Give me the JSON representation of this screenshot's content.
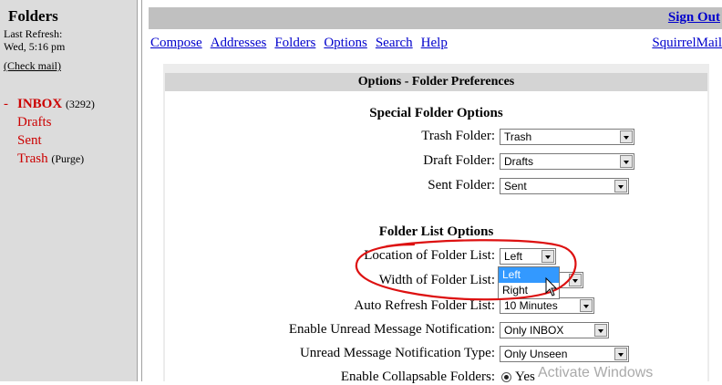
{
  "sidebar": {
    "title": "Folders",
    "last_refresh_label": "Last Refresh:",
    "last_refresh_time": "Wed, 5:16 pm",
    "check_mail": "(Check mail)",
    "folders": [
      {
        "name": "INBOX",
        "count": "(3292)",
        "prefix": "-"
      },
      {
        "name": "Drafts"
      },
      {
        "name": "Sent"
      },
      {
        "name": "Trash",
        "action": "(Purge)"
      }
    ]
  },
  "topbar": {
    "sign_out": "Sign Out"
  },
  "nav": {
    "links": [
      "Compose",
      "Addresses",
      "Folders",
      "Options",
      "Search",
      "Help"
    ],
    "brand": "SquirrelMail"
  },
  "options": {
    "header": "Options - Folder Preferences",
    "special_section": "Special Folder Options",
    "trash_label": "Trash Folder:",
    "trash_value": "Trash",
    "draft_label": "Draft Folder:",
    "draft_value": "Drafts",
    "sent_label": "Sent Folder:",
    "sent_value": "Sent",
    "list_section": "Folder List Options",
    "location_label": "Location of Folder List:",
    "location_value": "Left",
    "location_options": [
      "Left",
      "Right"
    ],
    "width_label": "Width of Folder List:",
    "refresh_label": "Auto Refresh Folder List:",
    "refresh_value": "10 Minutes",
    "unread_notify_label": "Enable Unread Message Notification:",
    "unread_notify_value": "Only INBOX",
    "unread_type_label": "Unread Message Notification Type:",
    "unread_type_value": "Only Unseen",
    "collapsible_label": "Enable Collapsable Folders:",
    "collapsible_value": "Yes"
  },
  "watermark": "Activate Windows",
  "colors": {
    "link": "#0000cc",
    "folder": "#cc0000",
    "annotation": "#dd1111",
    "highlight": "#3399ff"
  }
}
